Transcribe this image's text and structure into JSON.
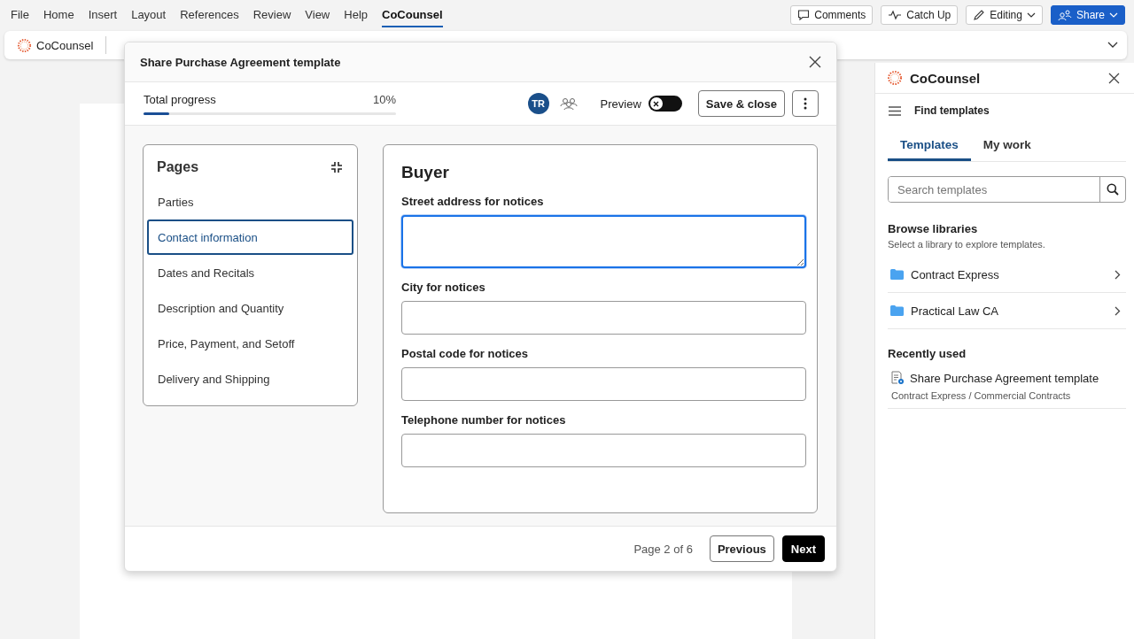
{
  "menu": [
    {
      "label": "File",
      "selected": false
    },
    {
      "label": "Home",
      "selected": false
    },
    {
      "label": "Insert",
      "selected": false
    },
    {
      "label": "Layout",
      "selected": false
    },
    {
      "label": "References",
      "selected": false
    },
    {
      "label": "Review",
      "selected": false
    },
    {
      "label": "View",
      "selected": false
    },
    {
      "label": "Help",
      "selected": false
    },
    {
      "label": "CoCounsel",
      "selected": true
    }
  ],
  "top_buttons": [
    {
      "kind": "comments",
      "label": "Comments"
    },
    {
      "kind": "catchup",
      "label": "Catch Up"
    },
    {
      "kind": "editing",
      "label": "Editing"
    },
    {
      "kind": "share",
      "label": "Share"
    }
  ],
  "ribbon": {
    "label": "CoCounsel"
  },
  "dialog": {
    "title": "Share Purchase Agreement template",
    "progress_label": "Total progress",
    "progress_value": "10%",
    "level": 0.1,
    "avatar": "TR",
    "preview_label": "Preview",
    "preview_on": false,
    "save_button": "Save & close",
    "pages_title": "Pages",
    "pages": [
      {
        "label": "Parties",
        "selected": false
      },
      {
        "label": "Contact information",
        "selected": true
      },
      {
        "label": "Dates and Recitals",
        "selected": false
      },
      {
        "label": "Description and Quantity",
        "selected": false
      },
      {
        "label": "Price, Payment, and Setoff",
        "selected": false
      },
      {
        "label": "Delivery and Shipping",
        "selected": false
      }
    ],
    "section_title": "Buyer",
    "fields": [
      {
        "label": "Street address for notices",
        "kind": "textarea",
        "focused": true
      },
      {
        "label": "City for notices",
        "kind": "input",
        "focused": false
      },
      {
        "label": "Postal code for notices",
        "kind": "input",
        "focused": false
      },
      {
        "label": "Telephone number for notices",
        "kind": "input",
        "focused": false
      }
    ],
    "page_indicator": "Page 2 of 6",
    "previous_button": "Previous",
    "next_button": "Next"
  },
  "panel": {
    "title": "CoCounsel",
    "nav_label": "Find templates",
    "tabs": [
      {
        "label": "Templates",
        "selected": true
      },
      {
        "label": "My work",
        "selected": false
      }
    ],
    "search": {
      "placeholder": "Search templates"
    },
    "browse_title": "Browse libraries",
    "browse_subtitle": "Select a library to explore templates.",
    "libraries": [
      "Contract Express",
      "Practical Law CA"
    ],
    "recent_title": "Recently used",
    "recent": [
      {
        "title": "Share Purchase Agreement template",
        "path": "Contract Express / Commercial Contracts"
      }
    ]
  }
}
